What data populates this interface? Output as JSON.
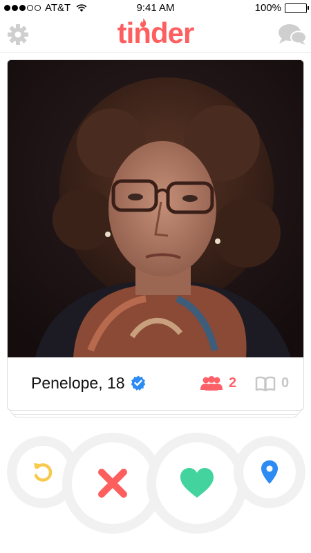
{
  "status_bar": {
    "carrier": "AT&T",
    "time": "9:41 AM",
    "battery": "100%"
  },
  "header": {
    "logo_text": "tinder",
    "left_icon": "gear-icon",
    "right_icon": "chat-bubbles-icon"
  },
  "card": {
    "name_age": "Penelope, 18",
    "verified": true,
    "shared_friends": "2",
    "shared_interests": "0",
    "photo_description_icon": "profile-photo"
  },
  "actions": [
    {
      "name": "rewind",
      "icon": "rewind-icon",
      "color": "#f7c94c"
    },
    {
      "name": "nope",
      "icon": "x-icon",
      "color": "#fd5f5f"
    },
    {
      "name": "like",
      "icon": "heart-icon",
      "color": "#43d39e"
    },
    {
      "name": "location",
      "icon": "pin-icon",
      "color": "#2c8cf4"
    }
  ],
  "colors": {
    "brand": "#fd5f5f",
    "verified": "#2c8cf4",
    "gray_icon": "#cfcfcf"
  }
}
